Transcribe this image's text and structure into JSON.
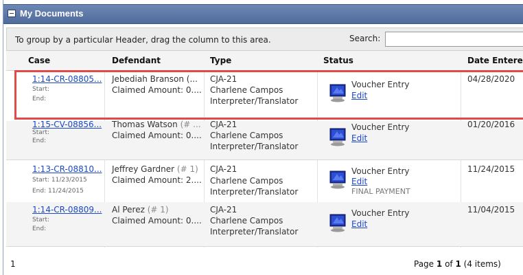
{
  "panel": {
    "title": "My Documents"
  },
  "groupbar": {
    "hint": "To group by a particular Header, drag the column to this area.",
    "search_label": "Search:",
    "search_value": ""
  },
  "columns": [
    "Case",
    "Defendant",
    "Type",
    "Status",
    "Date Entere"
  ],
  "rows": [
    {
      "case": "1:14-CR-08805...",
      "start": "Start:",
      "end": "End:",
      "defendant": "Jebediah Branson (...",
      "defendant_num": "",
      "claimed": "Claimed Amount: 0....",
      "type": "CJA-21",
      "person": "Charlene Campos",
      "role": "Interpreter/Translator",
      "status": "Voucher Entry",
      "edit": "Edit",
      "note": "",
      "date": "04/28/2020"
    },
    {
      "case": "1:15-CV-08856...",
      "start": "Start:",
      "end": "End:",
      "defendant": "Thomas Watson",
      "defendant_num": "(# ...",
      "claimed": "Claimed Amount: 0....",
      "type": "CJA-21",
      "person": "Charlene Campos",
      "role": "Interpreter/Translator",
      "status": "Voucher Entry",
      "edit": "Edit",
      "note": "",
      "date": "01/20/2016"
    },
    {
      "case": "1:13-CR-08810...",
      "start": "Start: 11/23/2015",
      "end": "End: 11/24/2015",
      "defendant": "Jeffrey Gardner",
      "defendant_num": "(# 1)",
      "claimed": "Claimed Amount: 2....",
      "type": "CJA-21",
      "person": "Charlene Campos",
      "role": "Interpreter/Translator",
      "status": "Voucher Entry",
      "edit": "Edit",
      "note": "FINAL PAYMENT",
      "date": "11/24/2015"
    },
    {
      "case": "1:14-CR-08809...",
      "start": "Start:",
      "end": "End:",
      "defendant": "Al Perez",
      "defendant_num": "(# 1)",
      "claimed": "Claimed Amount: 0....",
      "type": "CJA-21",
      "person": "Charlene Campos",
      "role": "Interpreter/Translator",
      "status": "Voucher Entry",
      "edit": "Edit",
      "note": "",
      "date": "11/04/2015"
    }
  ],
  "footer": {
    "page_number": "1",
    "page_prefix": "Page",
    "page_current": "1",
    "page_of": "of",
    "page_total": "1",
    "items": "(4 items)"
  }
}
